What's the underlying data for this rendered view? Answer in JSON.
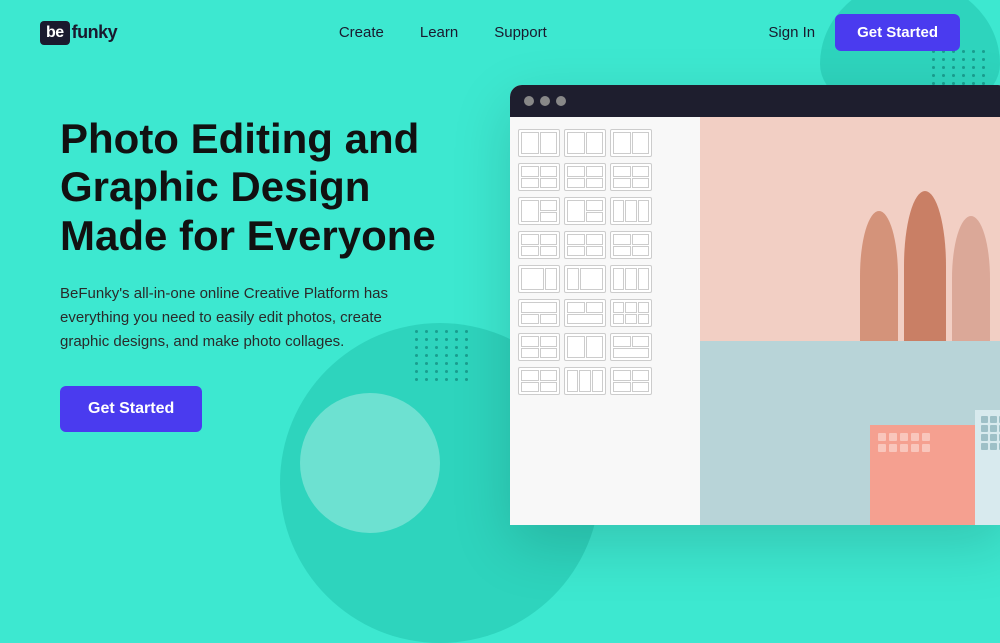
{
  "logo": {
    "be": "be",
    "funky": "funky"
  },
  "nav": {
    "links": [
      {
        "label": "Create",
        "id": "create"
      },
      {
        "label": "Learn",
        "id": "learn"
      },
      {
        "label": "Support",
        "id": "support"
      }
    ],
    "sign_in": "Sign In",
    "get_started": "Get Started"
  },
  "hero": {
    "title": "Photo Editing and\nGraphic Design\nMade for Everyone",
    "description": "BeFunky's all-in-one online Creative Platform has everything you need to easily edit photos, create graphic designs, and make photo collages.",
    "cta": "Get Started"
  },
  "dots_right": "· · · · · ·",
  "dots_mid": "· · · · · ·"
}
